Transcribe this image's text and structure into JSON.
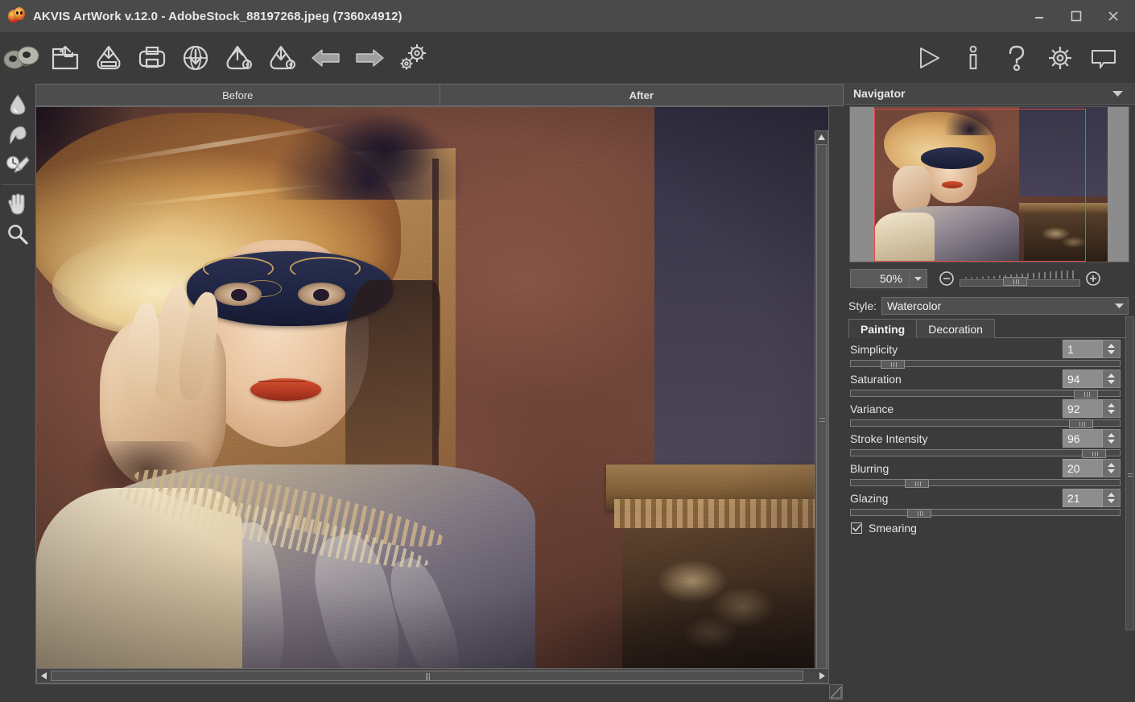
{
  "window": {
    "title": "AKVIS ArtWork v.12.0 - AdobeStock_88197268.jpeg (7360x4912)",
    "logo_icon": "akvis-mask-logo-icon",
    "minimize_label": "minimize-icon",
    "maximize_label": "maximize-icon",
    "close_label": "close-icon"
  },
  "toolbar": {
    "left_items": [
      {
        "name": "akvis-logo-button",
        "icon": "akvis-mask-logo-icon",
        "label": "AKVIS"
      },
      {
        "name": "open-image-button",
        "icon": "open-folder-icon",
        "label": "Open Image"
      },
      {
        "name": "save-image-button",
        "icon": "save-disk-icon",
        "label": "Save Image"
      },
      {
        "name": "print-image-button",
        "icon": "printer-icon",
        "label": "Print Image"
      },
      {
        "name": "publish-button",
        "icon": "globe-download-icon",
        "label": "Publish Image"
      },
      {
        "name": "save-preset-button",
        "icon": "export-preset-gear-icon",
        "label": "Save Preset"
      },
      {
        "name": "load-preset-button",
        "icon": "import-preset-gear-icon",
        "label": "Load Preset"
      },
      {
        "name": "undo-button",
        "icon": "arrow-left-icon",
        "label": "Undo"
      },
      {
        "name": "redo-button",
        "icon": "arrow-right-icon",
        "label": "Redo"
      },
      {
        "name": "batch-processing-button",
        "icon": "double-gears-icon",
        "label": "Batch Processing"
      }
    ],
    "right_items": [
      {
        "name": "run-button",
        "icon": "play-triangle-icon",
        "label": "Run"
      },
      {
        "name": "about-button",
        "icon": "info-icon",
        "label": "About"
      },
      {
        "name": "help-button",
        "icon": "question-mark-icon",
        "label": "Help"
      },
      {
        "name": "preferences-button",
        "icon": "gear-icon",
        "label": "Preferences"
      },
      {
        "name": "comments-button",
        "icon": "speech-bubble-icon",
        "label": "Comments"
      }
    ]
  },
  "tool_palette": {
    "items": [
      {
        "name": "tool-smudge",
        "icon": "water-drop-icon",
        "label": "Smudge"
      },
      {
        "name": "tool-stroke-direction",
        "icon": "stroke-direction-icon",
        "label": "Stroke Direction"
      },
      {
        "name": "tool-history-brush",
        "icon": "history-brush-icon",
        "label": "History Brush"
      },
      {
        "name": "tool-hand",
        "icon": "hand-icon",
        "label": "Hand"
      },
      {
        "name": "tool-zoom",
        "icon": "magnifier-icon",
        "label": "Zoom"
      }
    ]
  },
  "image_area": {
    "tabs": [
      {
        "name": "tab-before",
        "label": "Before",
        "active": false
      },
      {
        "name": "tab-after",
        "label": "After",
        "active": true
      }
    ],
    "scroll": {
      "up_icon": "triangle-up-icon",
      "down_icon": "triangle-down-icon",
      "left_icon": "triangle-left-icon",
      "right_icon": "triangle-right-icon",
      "resize_icon": "resize-grip-icon"
    }
  },
  "navigator": {
    "title": "Navigator",
    "collapse_icon": "chevron-down-icon",
    "viewport_color": "#e04a4a",
    "zoom": {
      "value": "50%",
      "dropdown_icon": "chevron-down-icon",
      "minus_icon": "zoom-out-circle-icon",
      "plus_icon": "zoom-in-circle-icon"
    }
  },
  "style": {
    "label": "Style:",
    "value": "Watercolor",
    "dropdown_icon": "chevron-down-icon"
  },
  "settings_tabs": [
    {
      "name": "tab-painting",
      "label": "Painting",
      "active": true
    },
    {
      "name": "tab-decoration",
      "label": "Decoration",
      "active": false
    }
  ],
  "parameters": [
    {
      "name": "simplicity",
      "label": "Simplicity",
      "value": "1",
      "percent": 11
    },
    {
      "name": "saturation",
      "label": "Saturation",
      "value": "94",
      "percent": 86
    },
    {
      "name": "variance",
      "label": "Variance",
      "value": "92",
      "percent": 84
    },
    {
      "name": "stroke-intensity",
      "label": "Stroke Intensity",
      "value": "96",
      "percent": 89
    },
    {
      "name": "blurring",
      "label": "Blurring",
      "value": "20",
      "percent": 21
    },
    {
      "name": "glazing",
      "label": "Glazing",
      "value": "21",
      "percent": 22
    }
  ],
  "smearing": {
    "label": "Smearing",
    "checked": true,
    "check_icon": "checkmark-icon"
  },
  "colors": {
    "window_bg": "#3b3b3b",
    "titlebar_bg": "#4a4a4a",
    "panel_bg": "#454545",
    "text": "#e6e6e6",
    "accent_red": "#e04a4a",
    "spin_field": "#8d8d8d"
  }
}
